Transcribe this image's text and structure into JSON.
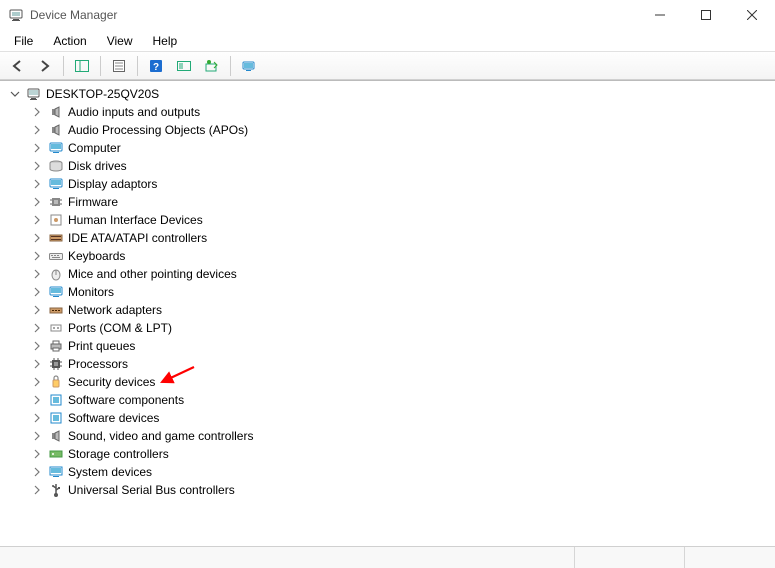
{
  "window": {
    "title": "Device Manager"
  },
  "menubar": {
    "items": [
      "File",
      "Action",
      "View",
      "Help"
    ]
  },
  "tree": {
    "root": {
      "label": "DESKTOP-25QV20S",
      "expanded": true
    },
    "children": [
      {
        "label": "Audio inputs and outputs",
        "icon": "speaker-icon"
      },
      {
        "label": "Audio Processing Objects (APOs)",
        "icon": "speaker-icon"
      },
      {
        "label": "Computer",
        "icon": "monitor-icon"
      },
      {
        "label": "Disk drives",
        "icon": "disk-icon"
      },
      {
        "label": "Display adaptors",
        "icon": "monitor-icon"
      },
      {
        "label": "Firmware",
        "icon": "chip-icon"
      },
      {
        "label": "Human Interface Devices",
        "icon": "hid-icon"
      },
      {
        "label": "IDE ATA/ATAPI controllers",
        "icon": "ide-icon"
      },
      {
        "label": "Keyboards",
        "icon": "keyboard-icon"
      },
      {
        "label": "Mice and other pointing devices",
        "icon": "mouse-icon"
      },
      {
        "label": "Monitors",
        "icon": "monitor-icon"
      },
      {
        "label": "Network adapters",
        "icon": "network-icon"
      },
      {
        "label": "Ports (COM & LPT)",
        "icon": "port-icon"
      },
      {
        "label": "Print queues",
        "icon": "printer-icon"
      },
      {
        "label": "Processors",
        "icon": "cpu-icon"
      },
      {
        "label": "Security devices",
        "icon": "security-icon"
      },
      {
        "label": "Software components",
        "icon": "software-icon"
      },
      {
        "label": "Software devices",
        "icon": "software-icon"
      },
      {
        "label": "Sound, video and game controllers",
        "icon": "speaker-icon"
      },
      {
        "label": "Storage controllers",
        "icon": "storage-icon"
      },
      {
        "label": "System devices",
        "icon": "system-icon"
      },
      {
        "label": "Universal Serial Bus controllers",
        "icon": "usb-icon"
      }
    ]
  },
  "annotation": {
    "arrow_target_index": 15,
    "color": "#ff0000"
  }
}
